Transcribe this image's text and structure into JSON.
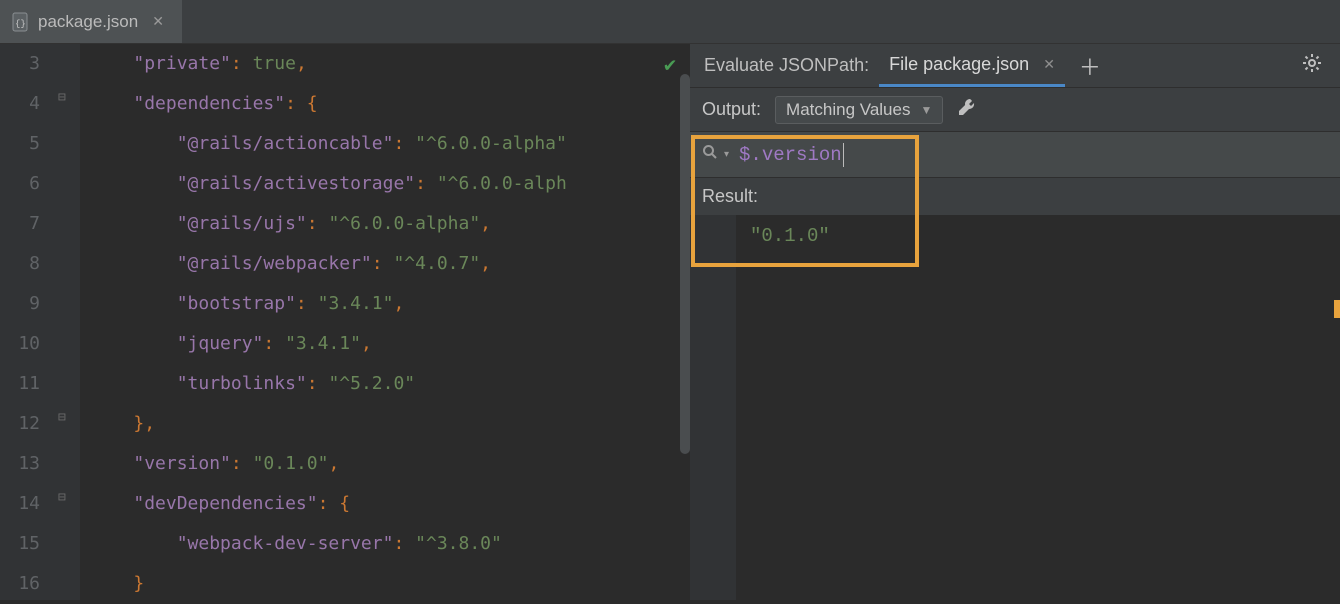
{
  "editor": {
    "tab_filename": "package.json",
    "line_numbers": [
      "3",
      "4",
      "5",
      "6",
      "7",
      "8",
      "9",
      "10",
      "11",
      "12",
      "13",
      "14",
      "15",
      "16"
    ],
    "code_lines": [
      {
        "indent": "    ",
        "tokens": [
          [
            "k-key",
            "\"private\""
          ],
          [
            "k-punc",
            ": "
          ],
          [
            "k-str",
            "true"
          ],
          [
            "k-punc",
            ","
          ]
        ]
      },
      {
        "indent": "    ",
        "tokens": [
          [
            "k-key",
            "\"dependencies\""
          ],
          [
            "k-punc",
            ": {"
          ]
        ]
      },
      {
        "indent": "        ",
        "tokens": [
          [
            "k-key",
            "\"@rails/actioncable\""
          ],
          [
            "k-punc",
            ": "
          ],
          [
            "k-str",
            "\"^6.0.0-alpha\""
          ]
        ]
      },
      {
        "indent": "        ",
        "tokens": [
          [
            "k-key",
            "\"@rails/activestorage\""
          ],
          [
            "k-punc",
            ": "
          ],
          [
            "k-str",
            "\"^6.0.0-alph"
          ]
        ]
      },
      {
        "indent": "        ",
        "tokens": [
          [
            "k-key",
            "\"@rails/ujs\""
          ],
          [
            "k-punc",
            ": "
          ],
          [
            "k-str",
            "\"^6.0.0-alpha\""
          ],
          [
            "k-punc",
            ","
          ]
        ]
      },
      {
        "indent": "        ",
        "tokens": [
          [
            "k-key",
            "\"@rails/webpacker\""
          ],
          [
            "k-punc",
            ": "
          ],
          [
            "k-str",
            "\"^4.0.7\""
          ],
          [
            "k-punc",
            ","
          ]
        ]
      },
      {
        "indent": "        ",
        "tokens": [
          [
            "k-key",
            "\"bootstrap\""
          ],
          [
            "k-punc",
            ": "
          ],
          [
            "k-str",
            "\"3.4.1\""
          ],
          [
            "k-punc",
            ","
          ]
        ]
      },
      {
        "indent": "        ",
        "tokens": [
          [
            "k-key",
            "\"jquery\""
          ],
          [
            "k-punc",
            ": "
          ],
          [
            "k-str",
            "\"3.4.1\""
          ],
          [
            "k-punc",
            ","
          ]
        ]
      },
      {
        "indent": "        ",
        "tokens": [
          [
            "k-key",
            "\"turbolinks\""
          ],
          [
            "k-punc",
            ": "
          ],
          [
            "k-str",
            "\"^5.2.0\""
          ]
        ]
      },
      {
        "indent": "    ",
        "tokens": [
          [
            "k-punc",
            "},"
          ]
        ]
      },
      {
        "indent": "    ",
        "tokens": [
          [
            "k-key",
            "\"version\""
          ],
          [
            "k-punc",
            ": "
          ],
          [
            "k-str",
            "\"0.1.0\""
          ],
          [
            "k-punc",
            ","
          ]
        ]
      },
      {
        "indent": "    ",
        "tokens": [
          [
            "k-key",
            "\"devDependencies\""
          ],
          [
            "k-punc",
            ": {"
          ]
        ]
      },
      {
        "indent": "        ",
        "tokens": [
          [
            "k-key",
            "\"webpack-dev-server\""
          ],
          [
            "k-punc",
            ": "
          ],
          [
            "k-str",
            "\"^3.8.0\""
          ]
        ]
      },
      {
        "indent": "    ",
        "tokens": [
          [
            "k-punc",
            "}"
          ]
        ]
      }
    ]
  },
  "tool": {
    "title": "Evaluate JSONPath:",
    "tab_label": "File package.json",
    "output_label": "Output:",
    "dropdown_value": "Matching Values",
    "query_text": "$.version",
    "result_label": "Result:",
    "result_value": "\"0.1.0\""
  }
}
